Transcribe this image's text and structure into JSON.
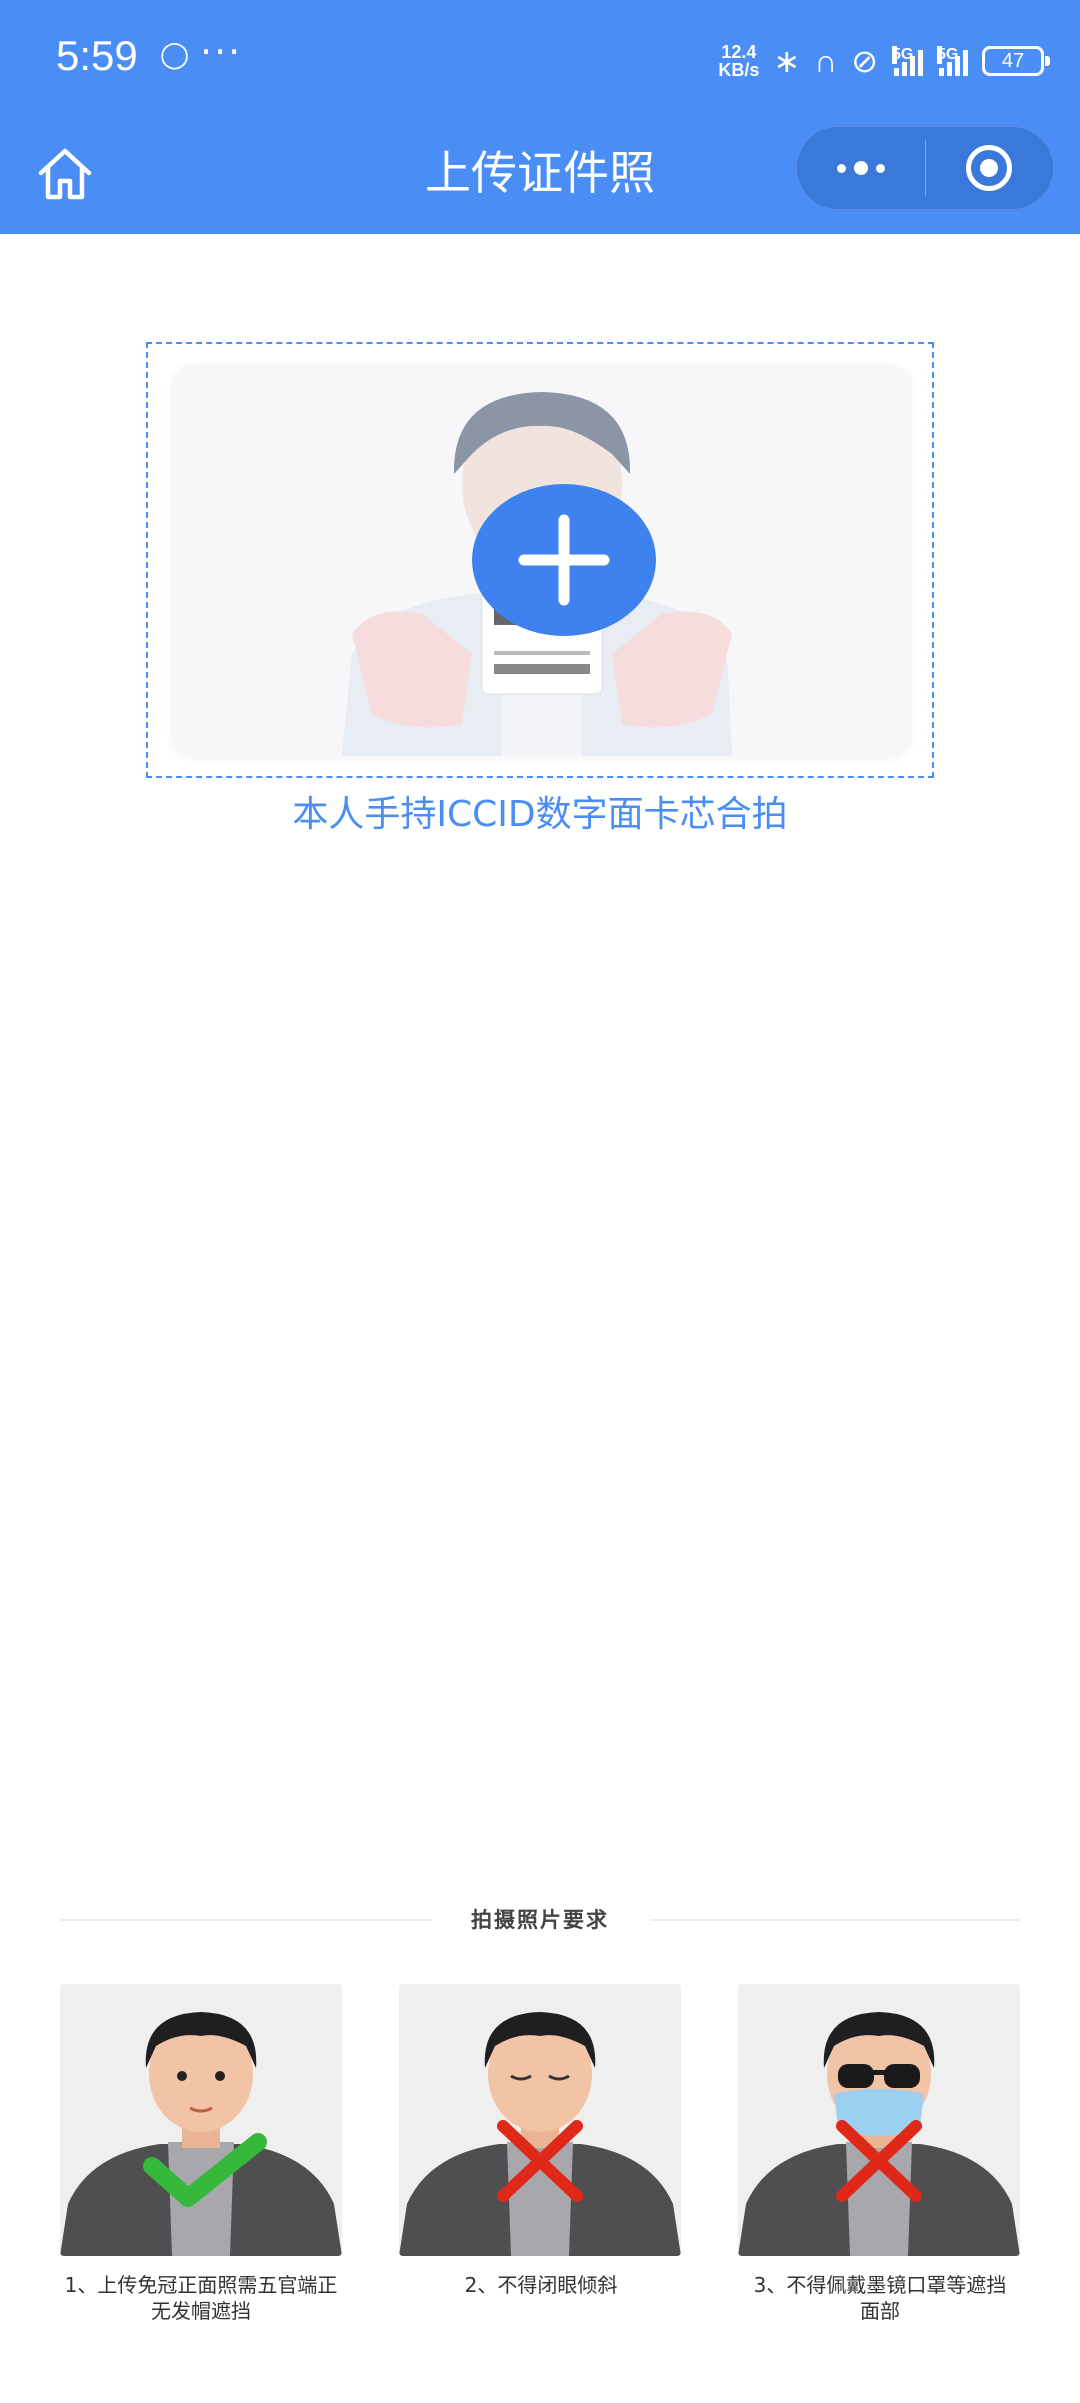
{
  "status_bar": {
    "time": "5:59",
    "more": "···",
    "net_speed_value": "12.4",
    "net_speed_unit": "KB/s",
    "signal1_label": "5G",
    "signal2_label": "5G",
    "battery": "47"
  },
  "nav": {
    "title": "上传证件照",
    "icons": [
      "home-icon",
      "more-dots-icon",
      "close-target-icon"
    ]
  },
  "upload": {
    "caption": "本人手持ICCID数字面卡芯合拍",
    "action_icon": "plus-icon"
  },
  "requirements": {
    "title": "拍摄照片要求",
    "items": [
      {
        "label_line1": "1、上传免冠正面照需五官端正",
        "label_line2": "无发帽遮挡",
        "mark": "check",
        "mark_color": "#36b83a"
      },
      {
        "label_line1": "2、不得闭眼倾斜",
        "label_line2": "",
        "mark": "cross",
        "mark_color": "#e02818"
      },
      {
        "label_line1": "3、不得佩戴墨镜口罩等遮挡",
        "label_line2": "面部",
        "mark": "cross",
        "mark_color": "#e02818"
      }
    ]
  },
  "colors": {
    "brand_blue": "#4a8ef5",
    "button_blue": "#3d82ee"
  }
}
